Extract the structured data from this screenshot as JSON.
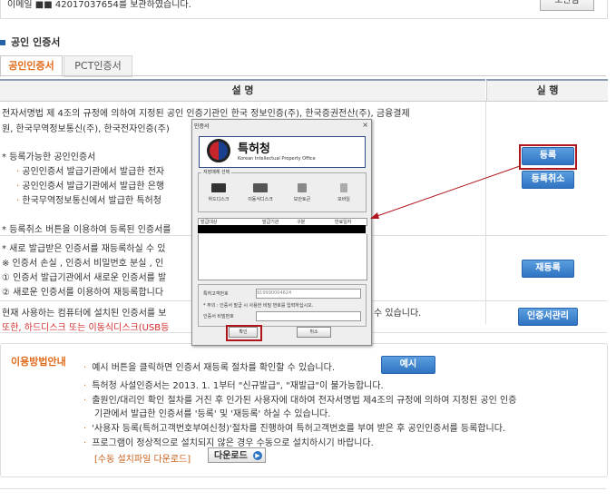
{
  "top": {
    "text": "이메일 ■■ 42017037654를 보관하였습니다.",
    "button": "보관함"
  },
  "section_title": "공인 인증서",
  "tabs": [
    {
      "label": "공인인증서",
      "active": true
    },
    {
      "label": "PCT인증서",
      "active": false
    }
  ],
  "table": {
    "head_desc": "설 명",
    "head_action": "실 행",
    "row1": {
      "line1": "전자서명법 제 4조의 규정에 의하여 지정된 공인 인증기관인 한국 정보인증(주), 한국증권전산(주), 금융결제",
      "line2": "원, 한국무역정보통신(주), 한국전자인증(주)",
      "list_title": "* 등록가능한 공인인증서",
      "items": [
        "공인인증서 발급기관에서 발급한 전자",
        "공인인증서 발급기관에서 발급한 은행",
        "한국무역정보통신에서 발급한 특허청"
      ],
      "footer": "* 등록취소 버튼을 이용하여 등록된 인증서를",
      "btn_register": "등록",
      "btn_cancel": "등록취소"
    },
    "row2": {
      "line1": "* 새로 발급받은 인증서를 재등록하실 수 있",
      "line2": "※ 인증서 손실 , 인증서 비밀번호 분실 , 인",
      "line3": "① 인증서 발급기관에서 새로운 인증서를 발",
      "line4": "② 새로운 인증서를 이용하여 재등록합니다",
      "btn": "재등록"
    },
    "row3": {
      "line1": "현재 사용하는 컴퓨터에 설치된 인증서를 보",
      "line1_tail": "수 있습니다.",
      "line2": "또한, 하드디스크 또는 이동식디스크(USB등",
      "btn": "인증서관리"
    }
  },
  "usage": {
    "title": "이용방법안내",
    "line1": "예시 버튼을 클릭하면 인증서 재등록 절차를 확인할 수 있습니다.",
    "example_btn": "예시",
    "line2": "특허청 사설인증서는 2013. 1. 1부터 \"신규발급\", \"재발급\"이 불가능합니다.",
    "line3a": "출원인/대리인 확인 절차를 거친 후 인가된 사용자에 대하여 전자서명법 제4조의 규정에 의하여 지정된 공인 인증",
    "line3b": "기관에서 발급한 인증서를 '등록' 및 '재등록' 하실 수 있습니다.",
    "line4": "'사용자 등록(특허고객번호부여신청)'절차를 진행하여 특허고객번호를 부여 받은 후 공인인증서를 등록합니다.",
    "line5": "프로그램이 정상적으로 설치되지 않은 경우 수동으로 설치하시기 바랍니다.",
    "manual_link": "[수동 설치파일 다운로드]",
    "download_btn": "다운로드"
  },
  "dialog": {
    "title": "인증서",
    "close": "×",
    "logo_ko": "특허청",
    "logo_en": "Korean Intellectual Property Office",
    "storage_label": "저장매체 선택",
    "drives": [
      "하드디스크",
      "이동식디스크",
      "보안토큰",
      "모바일"
    ],
    "cols": [
      "발급대상",
      "발급기관",
      "구분",
      "만료일자"
    ],
    "customer_label": "특허고객번호",
    "customer_value": "919990004624",
    "note": "* 주의 : 인증서 발급 시 사용한 비밀 번호를 입력하십시오.",
    "pw_label": "인증서 비밀번호",
    "ok": "확인",
    "cancel": "취소"
  },
  "colors": {
    "accent_orange": "#e26b1a",
    "button_blue": "#2f74c2",
    "highlight_red": "#b0151d"
  }
}
